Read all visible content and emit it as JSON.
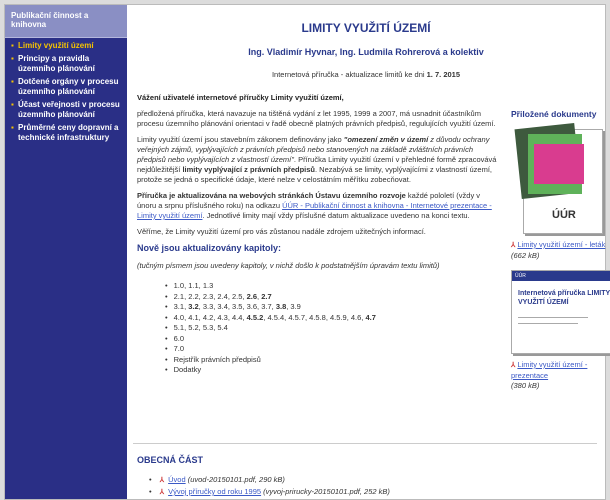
{
  "sidebar": {
    "header": "Publikační činnost a knihovna",
    "items": [
      {
        "label": "Limity využití území",
        "active": true
      },
      {
        "label": "Principy a pravidla územního plánování"
      },
      {
        "label": "Dotčené orgány v procesu územního plánování"
      },
      {
        "label": "Účast veřejnosti v procesu územního plánování"
      },
      {
        "label": "Průměrné ceny dopravní a technické infrastruktury"
      }
    ]
  },
  "main": {
    "title": "LIMITY VYUŽITÍ ÚZEMÍ",
    "authors": "Ing. Vladimír Hyvnar, Ing. Ludmila Rohrerová a kolektiv",
    "updated_prefix": "Internetová příručka - aktualizace limitů ke dni",
    "updated_date": "1. 7. 2015",
    "greeting": "Vážení uživatelé internetové příručky Limity využití území,",
    "p1": "předložená příručka, která navazuje na tištěná vydání z let 1995, 1999 a 2007, má usnadnit účastníkům procesu územního plánování orientaci v řadě obecně platných právních předpisů, regulujících využití území.",
    "p2_a": "Limity využití území jsou stavebním zákonem definovány jako ",
    "p2_b": "\"omezení změn v území",
    "p2_c": " z důvodu ochrany veřejných zájmů, vyplývajících z právních předpisů nebo stanovených na základě zvláštních právních předpisů nebo vyplývajících z vlastností území\"",
    "p2_d": ". Příručka Limity využití území v přehledné formě zpracovává nejdůležitější ",
    "p2_e": "limity vyplývající z právních předpisů",
    "p2_f": ". Nezabývá se limity, vyplývajícími z vlastností území, protože se jedná o specifické údaje, které nelze v celostátním měřítku zobecňovat.",
    "p3_a": "Příručka je aktualizována na webových stránkách Ústavu územního rozvoje",
    "p3_b": " každé pololetí (vždy v únoru a srpnu příslušného roku) na odkazu ",
    "p3_link": "ÚÚR - Publikační činnost a knihovna - Internetové prezentace - Limity využití území",
    "p3_c": ". Jednotlivé limity mají vždy příslušné datum aktualizace uvedeno na konci textu.",
    "p4": "Věříme, že Limity využití území pro vás zůstanou nadále zdrojem užitečných informací.",
    "updated_heading": "Nově jsou aktualizovány kapitoly:",
    "updated_note": "(tučným písmem jsou uvedeny kapitoly, v nichž došlo k podstatnějším úpravám textu limitů)",
    "chapters": [
      "1.0, 1.1, 1.3",
      "2.1, 2.2, 2.3, 2.4, 2.5, 2.6, 2.7",
      "3.1, 3.2, 3.3, 3.4, 3.5, 3.6, 3.7, 3.8, 3.9",
      "4.0, 4.1, 4.2, 4.3, 4.4, 4.5.2, 4.5.4, 4.5.7, 4.5.8, 4.5.9, 4.6, 4.7",
      "5.1, 5.2, 5.3, 5.4",
      "6.0",
      "7.0",
      "Rejstřík právních předpisů",
      "Dodatky"
    ]
  },
  "aside": {
    "heading": "Přiložené dokumenty",
    "book_logo": "ÚÚR",
    "doc1_link": "Limity využití území - leták",
    "doc1_size": "(662 kB)",
    "cover_header": "ÚÚR",
    "cover_title": "Internetová příručka LIMITY VYUŽITÍ ÚZEMÍ",
    "doc2_link": "Limity využití území - prezentace",
    "doc2_size": "(380 kB)",
    "pdf_icon_text": "⅄"
  },
  "general": {
    "heading": "OBECNÁ ČÁST",
    "files": [
      {
        "link": "Úvod",
        "info": "(uvod-20150101.pdf, 290 kB)"
      },
      {
        "link": "Vývoj příručky od roku 1995",
        "info": "(vyvoj-prirucky-20150101.pdf, 252 kB)"
      }
    ]
  }
}
